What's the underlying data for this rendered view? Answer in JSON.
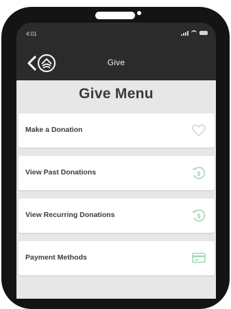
{
  "status_bar": {
    "time": "4:01"
  },
  "nav": {
    "title": "Give"
  },
  "menu": {
    "heading": "Give Menu",
    "items": [
      {
        "label": "Make a Donation",
        "icon": "heart-outline-icon"
      },
      {
        "label": "View Past Donations",
        "icon": "history-icon"
      },
      {
        "label": "View Recurring Donations",
        "icon": "history-icon"
      },
      {
        "label": "Payment Methods",
        "icon": "card-icon"
      }
    ]
  },
  "colors": {
    "header_bg": "#2b2b2b",
    "content_bg": "#e7e7e7",
    "accent_green": "#9fd6b4",
    "heart_gray": "#cfcfcf"
  }
}
